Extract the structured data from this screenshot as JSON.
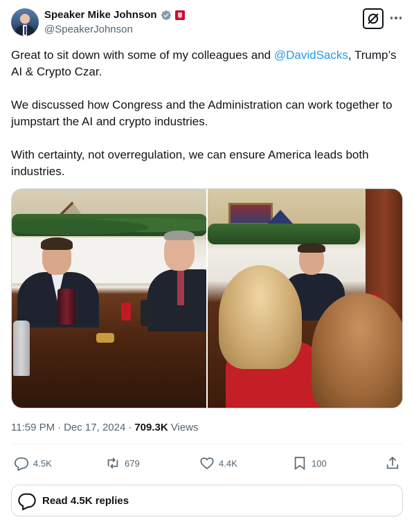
{
  "author": {
    "display_name": "Speaker Mike Johnson",
    "handle": "@SpeakerJohnson"
  },
  "icons": {
    "verified": "verified-badge-icon",
    "affiliation": "house-seal-icon",
    "grok": "grok-icon",
    "more": "more-icon",
    "reply": "reply-icon",
    "repost": "repost-icon",
    "like": "like-icon",
    "bookmark": "bookmark-icon",
    "share": "share-icon"
  },
  "colors": {
    "text": "#0f1419",
    "secondary": "#536471",
    "link": "#1d9bf0",
    "verified": "#829aab",
    "border": "#cfd9de"
  },
  "tweet": {
    "paragraph1_before": "Great to sit down with some of my colleagues and ",
    "mention": "@DavidSacks",
    "paragraph1_after": ", Trump’s AI & Crypto Czar.",
    "paragraph2": "We discussed how Congress and the Administration can work together to jumpstart the AI and crypto industries.",
    "paragraph3": "With certainty, not overregulation, we can ensure America leads both industries."
  },
  "meta": {
    "time": "11:59 PM",
    "separator1": "·",
    "date": "Dec 17, 2024",
    "separator2": "·",
    "views_count": "709.3K",
    "views_label": "Views"
  },
  "actions": {
    "replies": "4.5K",
    "reposts": "679",
    "likes": "4.4K",
    "bookmarks": "100"
  },
  "replies_box": {
    "label": "Read 4.5K replies"
  }
}
